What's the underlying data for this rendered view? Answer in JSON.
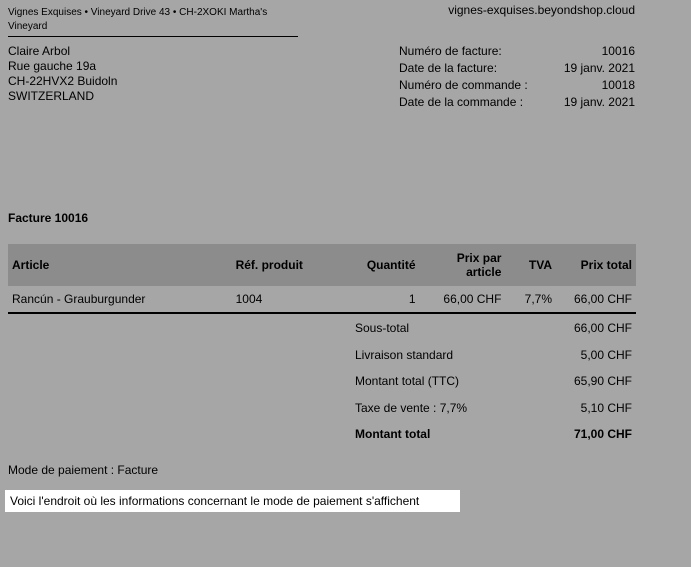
{
  "header": {
    "sender": "Vignes Exquises • Vineyard Drive 43 • CH-2XOKI Martha's Vineyard",
    "shop_url": "vignes-exquises.beyondshop.cloud"
  },
  "address": {
    "name": "Claire Arbol",
    "street": "Rue gauche 19a",
    "city": "CH-22HVX2 Buidoln",
    "country": "SWITZERLAND"
  },
  "meta": [
    {
      "label": "Numéro de facture:",
      "value": "10016"
    },
    {
      "label": "Date de la facture:",
      "value": "19 janv. 2021"
    },
    {
      "label": "Numéro de commande :",
      "value": "10018"
    },
    {
      "label": "Date de la commande :",
      "value": "19 janv. 2021"
    }
  ],
  "invoice_title": "Facture 10016",
  "table": {
    "headers": {
      "article": "Article",
      "ref": "Réf. produit",
      "qty": "Quantité",
      "unit_price_line1": "Prix par",
      "unit_price_line2": "article",
      "vat": "TVA",
      "total": "Prix total"
    },
    "rows": [
      {
        "article": "Rancún - Grauburgunder",
        "ref": "1004",
        "qty": "1",
        "unit_price": "66,00 CHF",
        "vat": "7,7%",
        "total": "66,00 CHF"
      }
    ]
  },
  "totals": [
    {
      "label": "Sous-total",
      "value": "66,00 CHF"
    },
    {
      "label": "Livraison standard",
      "value": "5,00 CHF"
    },
    {
      "label": "Montant total (TTC)",
      "value": "65,90 CHF"
    },
    {
      "label": "Taxe de vente : 7,7%",
      "value": "5,10 CHF"
    },
    {
      "label": "Montant total",
      "value": "71,00 CHF"
    }
  ],
  "payment": {
    "line": "Mode de paiement : Facture",
    "note": "Voici l'endroit où les informations concernant le mode de paiement s'affichent"
  }
}
